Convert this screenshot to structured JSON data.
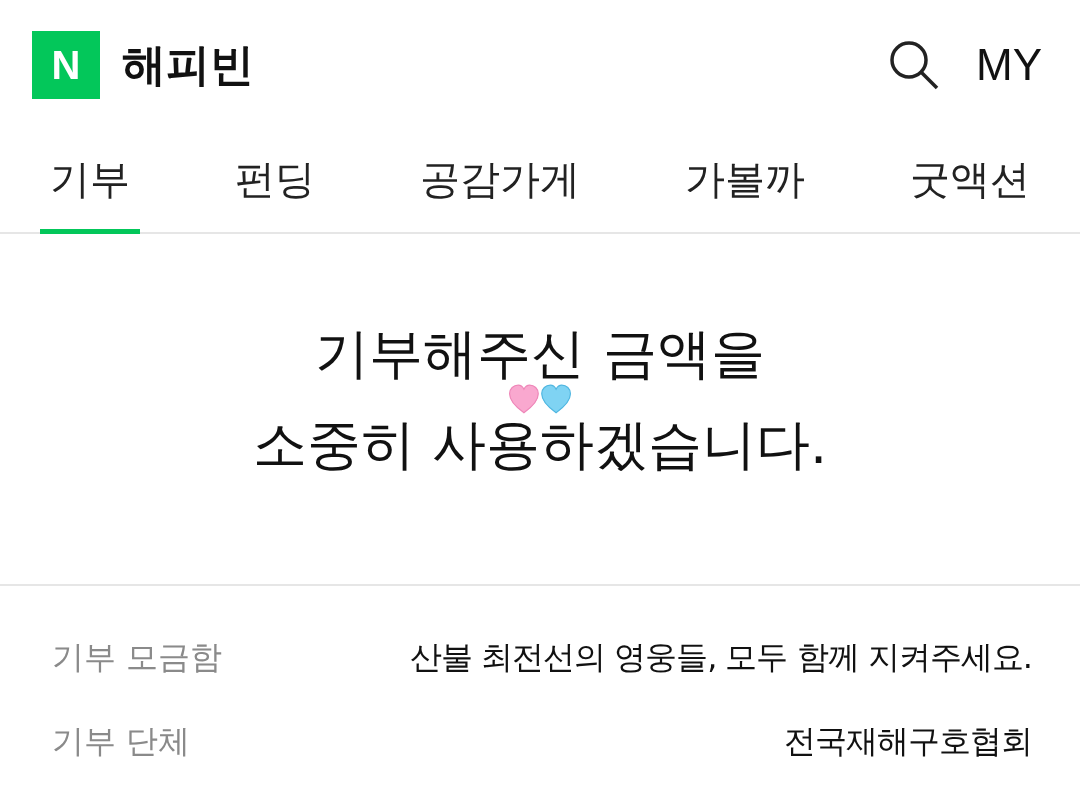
{
  "header": {
    "logo": "N",
    "title": "해피빈",
    "my": "MY"
  },
  "tabs": [
    {
      "label": "기부",
      "selected": true
    },
    {
      "label": "펀딩",
      "selected": false
    },
    {
      "label": "공감가게",
      "selected": false
    },
    {
      "label": "가볼까",
      "selected": false
    },
    {
      "label": "굿액션",
      "selected": false
    }
  ],
  "message": {
    "lines": [
      "기부해주신 금액을",
      "소중히 사용하겠습니다."
    ]
  },
  "details": [
    {
      "label": "기부 모금함",
      "value": "산불 최전선의 영웅들, 모두 함께 지켜주세요."
    },
    {
      "label": "기부 단체",
      "value": "전국재해구호협회"
    }
  ]
}
